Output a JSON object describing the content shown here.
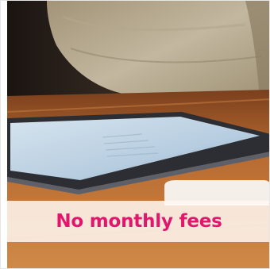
{
  "feature_card": {
    "image_subject": "tablet-on-table-photo",
    "caption": "No monthly fees",
    "colors": {
      "caption_text": "#e3166e",
      "caption_band": "#fff8f2",
      "table_wood": "#b8692f",
      "tablet_frame": "#2c2e33",
      "tablet_screen": "#bcd3e6",
      "sweater": "#b9ad93"
    }
  }
}
